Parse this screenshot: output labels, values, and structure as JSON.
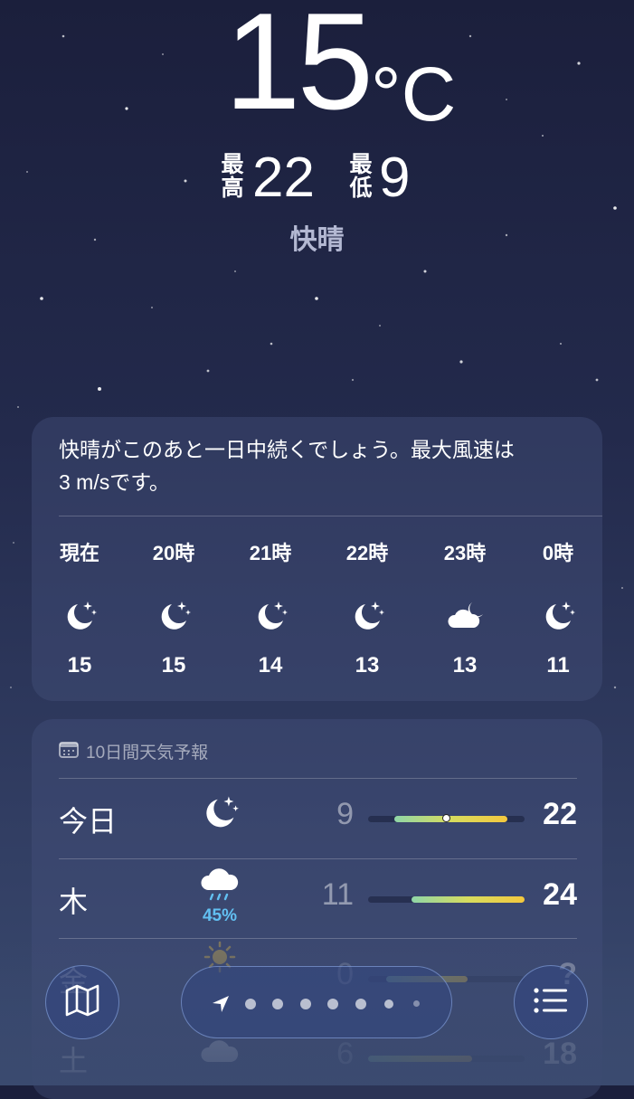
{
  "current": {
    "temperature": "15",
    "unit": "°C",
    "high_label": "最高",
    "high": "22",
    "low_label": "最低",
    "low": "9",
    "condition": "快晴"
  },
  "hourly": {
    "summary": "快晴がこのあと一日中続くでしょう。最大風速は\n3 m/sです。",
    "items": [
      {
        "time": "現在",
        "icon": "moon-stars-icon",
        "temp": "15"
      },
      {
        "time": "20時",
        "icon": "moon-stars-icon",
        "temp": "15"
      },
      {
        "time": "21時",
        "icon": "moon-stars-icon",
        "temp": "14"
      },
      {
        "time": "22時",
        "icon": "moon-stars-icon",
        "temp": "13"
      },
      {
        "time": "23時",
        "icon": "cloud-moon-icon",
        "temp": "13"
      },
      {
        "time": "0時",
        "icon": "moon-stars-icon",
        "temp": "11"
      }
    ]
  },
  "daily": {
    "header": "10日間天気予報",
    "range": [
      6,
      24
    ],
    "items": [
      {
        "day": "今日",
        "icon": "moon-stars-icon",
        "precip": "",
        "low": "9",
        "high": "22",
        "current": 15
      },
      {
        "day": "木",
        "icon": "cloud-rain-icon",
        "precip": "45%",
        "low": "11",
        "high": "24"
      },
      {
        "day": "金",
        "icon": "sun-icon",
        "precip": "",
        "low": "0",
        "high": "?"
      },
      {
        "day": "土",
        "icon": "cloud-icon",
        "precip": "",
        "low": "6",
        "high": "18"
      }
    ]
  },
  "tabbar": {
    "map_icon": "map-icon",
    "location_icon": "location-arrow-icon",
    "list_icon": "list-icon",
    "page_dots": 7
  },
  "colors": {
    "background_top": "#1b1f3c",
    "background_bottom": "#3a4a6f",
    "precip": "#62c0f2",
    "bar_start": "#8fd6a8",
    "bar_end": "#f4c83e"
  }
}
